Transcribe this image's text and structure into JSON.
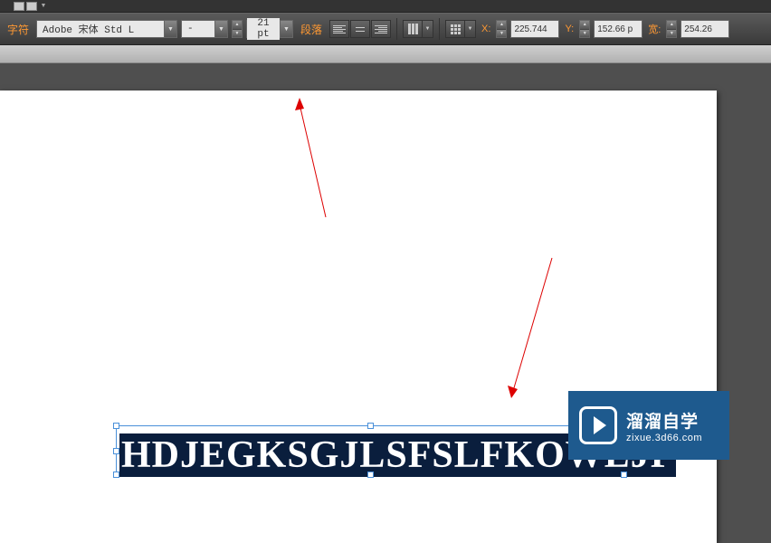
{
  "toolbar": {
    "char_label": "字符",
    "font_name": "Adobe 宋体 Std L",
    "font_style": "-",
    "font_size": "21 pt",
    "para_label": "段落",
    "x_label": "X:",
    "x_value": "225.744",
    "y_label": "Y:",
    "y_value": "152.66 p",
    "w_label": "宽:",
    "w_value": "254.26"
  },
  "canvas_text": "HDJEGKSGJLSFSLFKOWEJF",
  "watermark": {
    "title": "溜溜自学",
    "url": "zixue.3d66.com"
  }
}
